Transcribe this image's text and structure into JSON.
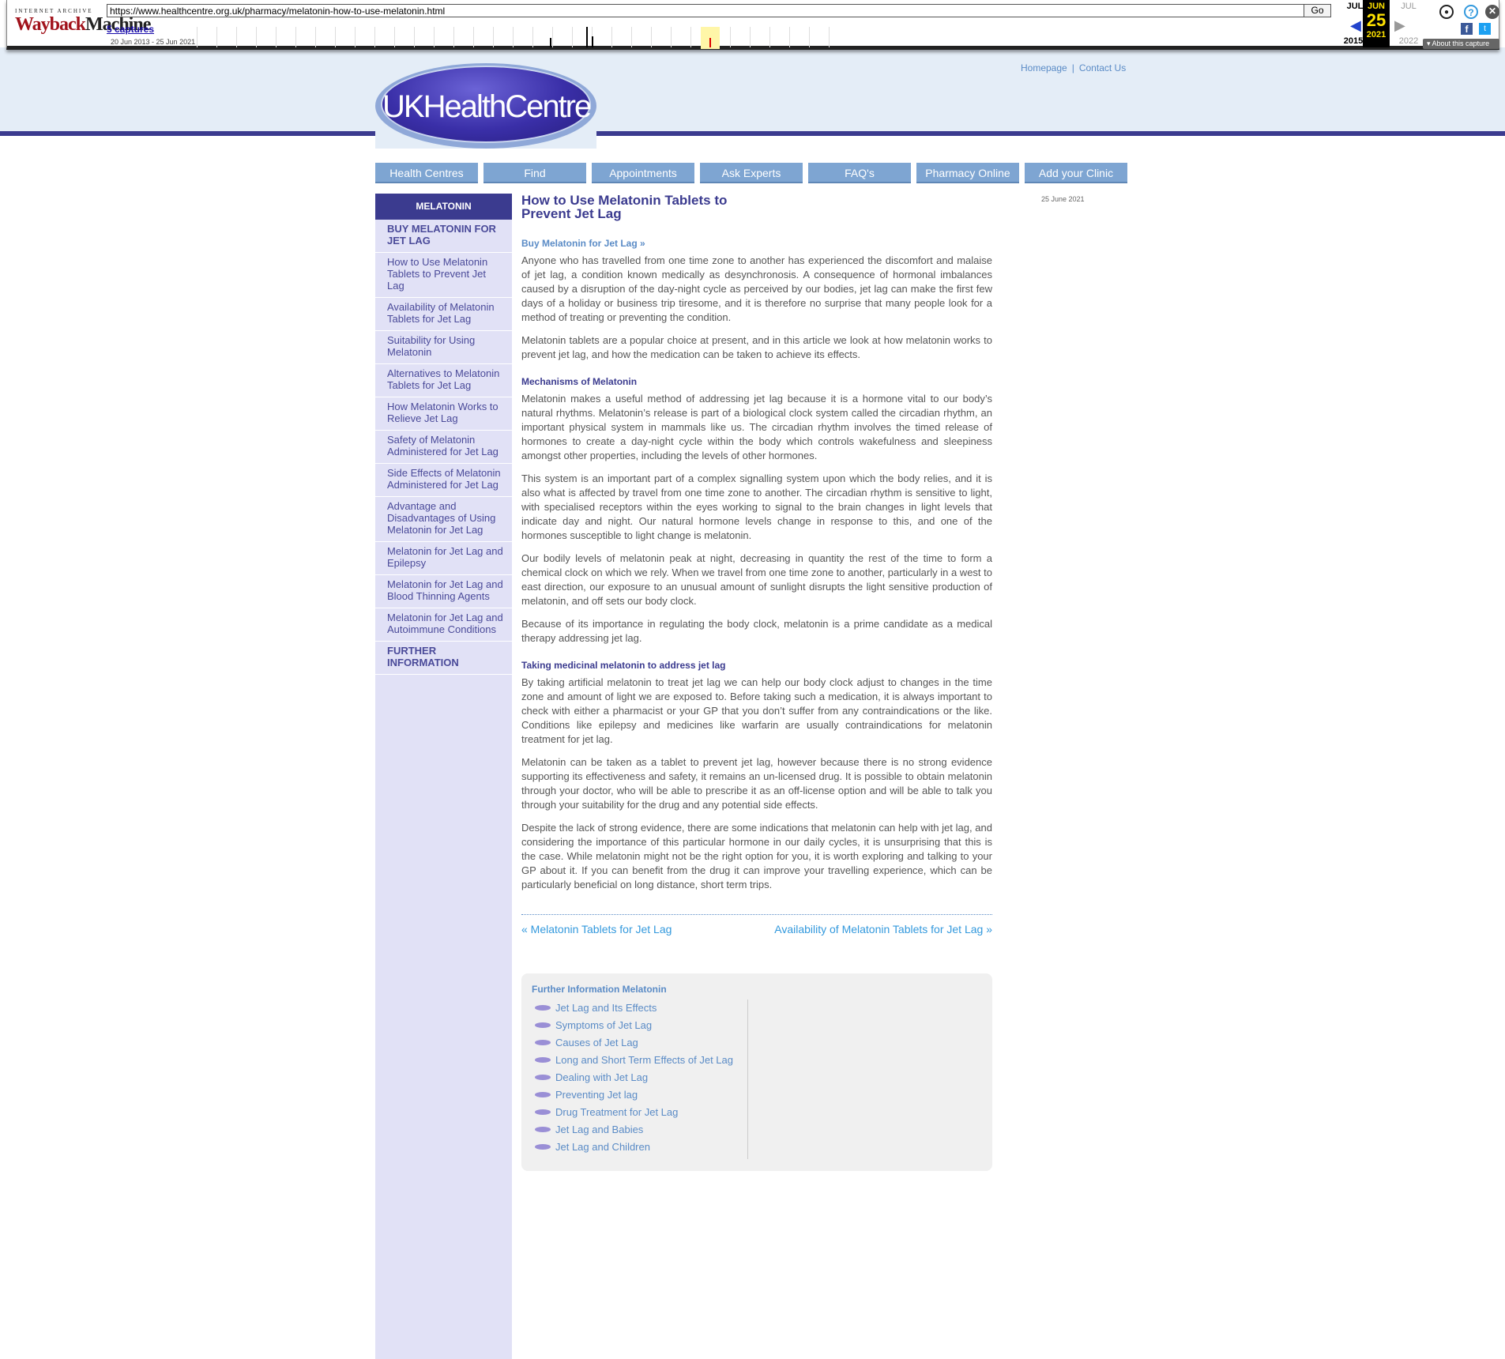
{
  "wayback": {
    "logo_top": "INTERNET ARCHIVE",
    "logo_part1": "Wayback",
    "logo_part2": "Machine",
    "url": "https://www.healthcentre.org.uk/pharmacy/melatonin-how-to-use-melatonin.html",
    "go_label": "Go",
    "captures_label": "5 captures",
    "range_label": "20 Jun 2013 - 25 Jun 2021",
    "prev_month": "JUL",
    "prev_year": "2015",
    "cur_month": "JUN",
    "cur_day": "25",
    "cur_year": "2021",
    "next_month": "JUL",
    "next_year": "2022",
    "about_label": "About this capture",
    "colors": {
      "current_bg": "#000000",
      "current_fg": "#ffe300",
      "logo_red": "#a1121b"
    }
  },
  "site": {
    "logo_text": "UKHealthCentre",
    "toplinks": [
      {
        "label": "Homepage"
      },
      {
        "label": "Contact Us"
      }
    ],
    "nav": [
      {
        "label": "Health Centres"
      },
      {
        "label": "Find"
      },
      {
        "label": "Appointments"
      },
      {
        "label": "Ask Experts"
      },
      {
        "label": "FAQ's"
      },
      {
        "label": "Pharmacy Online"
      },
      {
        "label": "Add your Clinic"
      }
    ],
    "colors": {
      "brand": "#3b3b8f",
      "link": "#5a8bc6",
      "nav": "#7ea5d2",
      "sidebar": "#e1e1f6"
    }
  },
  "sidebar": {
    "heading": "MELATONIN",
    "items": [
      {
        "label": "BUY MELATONIN FOR JET LAG"
      },
      {
        "label": "How to Use Melatonin Tablets to Prevent Jet Lag"
      },
      {
        "label": "Availability of Melatonin Tablets for Jet Lag"
      },
      {
        "label": "Suitability for Using Melatonin"
      },
      {
        "label": "Alternatives to Melatonin Tablets for Jet Lag"
      },
      {
        "label": "How Melatonin Works to Relieve Jet Lag"
      },
      {
        "label": "Safety of Melatonin Administered for Jet Lag"
      },
      {
        "label": "Side Effects of Melatonin Administered for Jet Lag"
      },
      {
        "label": "Advantage and Disadvantages of Using Melatonin for Jet Lag"
      },
      {
        "label": "Melatonin for Jet Lag and Epilepsy"
      },
      {
        "label": "Melatonin for Jet Lag and Blood Thinning Agents"
      },
      {
        "label": "Melatonin for Jet Lag and Autoimmune Conditions"
      },
      {
        "label": "FURTHER INFORMATION"
      }
    ]
  },
  "article": {
    "title": "How to Use Melatonin Tablets to Prevent Jet Lag",
    "date": "25 June 2021",
    "buy_link": "Buy Melatonin for Jet Lag »",
    "intro": [
      "Anyone who has travelled from one time zone to another has experienced the discomfort and malaise of jet lag, a condition known medically as desynchronosis. A consequence of hormonal imbalances caused by a disruption of the day-night cycle as perceived by our bodies, jet lag can make the first few days of a holiday or business trip tiresome, and it is therefore no surprise that many people look for a method of treating or preventing the condition.",
      "Melatonin tablets are a popular choice at present, and in this article we look at how melatonin works to prevent jet lag, and how the medication can be taken to achieve its effects."
    ],
    "section1_title": "Mechanisms of Melatonin",
    "section1": [
      "Melatonin makes a useful method of addressing jet lag because it is a hormone vital to our body’s natural rhythms. Melatonin’s release is part of a biological clock system called the circadian rhythm, an important physical system in mammals like us. The circadian rhythm involves the timed release of hormones to create a day-night cycle within the body which controls wakefulness and sleepiness amongst other properties, including the levels of other hormones.",
      "This system is an important part of a complex signalling system upon which the body relies, and it is also what is affected by travel from one time zone to another. The circadian rhythm is sensitive to light, with specialised receptors within the eyes working to signal to the brain changes in light levels that indicate day and night. Our natural hormone levels change in response to this, and one of the hormones susceptible to light change is melatonin.",
      "Our bodily levels of melatonin peak at night, decreasing in quantity the rest of the time to form a chemical clock on which we rely. When we travel from one time zone to another, particularly in a west to east direction, our exposure to an unusual amount of sunlight disrupts the light sensitive production of melatonin, and off sets our body clock.",
      "Because of its importance in regulating the body clock, melatonin is a prime candidate as a medical therapy addressing jet lag."
    ],
    "section2_title": "Taking medicinal melatonin to address jet lag",
    "section2": [
      "By taking artificial melatonin to treat jet lag we can help our body clock adjust to changes in the time zone and amount of light we are exposed to. Before taking such a medication, it is always important to check with either a pharmacist or your GP that you don’t suffer from any contraindications or the like. Conditions like epilepsy and medicines like warfarin are usually contraindications for melatonin treatment for jet lag.",
      "Melatonin can be taken as a tablet to prevent jet lag, however because there is no strong evidence supporting its effectiveness and safety, it remains an un-licensed drug. It is possible to obtain melatonin through your doctor, who will be able to prescribe it as an off-license option and will be able to talk you through your suitability for the drug and any potential side effects.",
      "Despite the lack of strong evidence, there are some indications that melatonin can help with jet lag, and considering the importance of this particular hormone in our daily cycles, it is unsurprising that this is the case. While melatonin might not be the right option for you, it is worth exploring and talking to your GP about it. If you can benefit from the drug it can improve your travelling experience, which can be particularly beneficial on long distance, short term trips."
    ],
    "prev_link": "« Melatonin Tablets for Jet Lag",
    "next_link": "Availability of Melatonin Tablets for Jet Lag »"
  },
  "further": {
    "title": "Further Information Melatonin",
    "items": [
      {
        "label": "Jet Lag and Its Effects"
      },
      {
        "label": "Symptoms of Jet Lag"
      },
      {
        "label": "Causes of Jet Lag"
      },
      {
        "label": "Long and Short Term Effects of Jet Lag"
      },
      {
        "label": "Dealing with Jet Lag"
      },
      {
        "label": "Preventing Jet lag"
      },
      {
        "label": "Drug Treatment for Jet Lag"
      },
      {
        "label": "Jet Lag and Babies"
      },
      {
        "label": "Jet Lag and Children"
      }
    ]
  }
}
